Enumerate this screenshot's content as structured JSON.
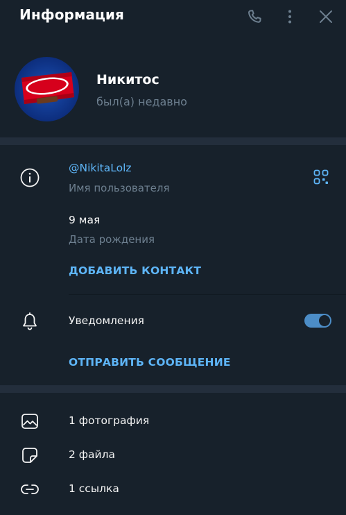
{
  "header": {
    "title": "Информация",
    "call_icon": "phone-icon",
    "more_icon": "vertical-dots-icon",
    "close_icon": "close-icon"
  },
  "profile": {
    "name": "Никитос",
    "status": "был(а) недавно",
    "avatar_logo_text": "KitKat"
  },
  "info": {
    "username": "@NikitaLolz",
    "username_label": "Имя пользователя",
    "birthday": "9 мая",
    "birthday_label": "Дата рождения",
    "add_contact": "ДОБАВИТЬ КОНТАКТ",
    "notifications_label": "Уведомления",
    "notifications_enabled": true,
    "send_message": "ОТПРАВИТЬ СООБЩЕНИЕ"
  },
  "media": [
    {
      "label": "1 фотография",
      "icon": "photo-icon"
    },
    {
      "label": "2 файла",
      "icon": "file-icon"
    },
    {
      "label": "1 ссылка",
      "icon": "link-icon"
    }
  ],
  "colors": {
    "background": "#17212b",
    "separator": "#232e3c",
    "accent": "#5eb5f7",
    "toggle": "#4c8dc7",
    "muted_text": "#6d7f8f"
  }
}
